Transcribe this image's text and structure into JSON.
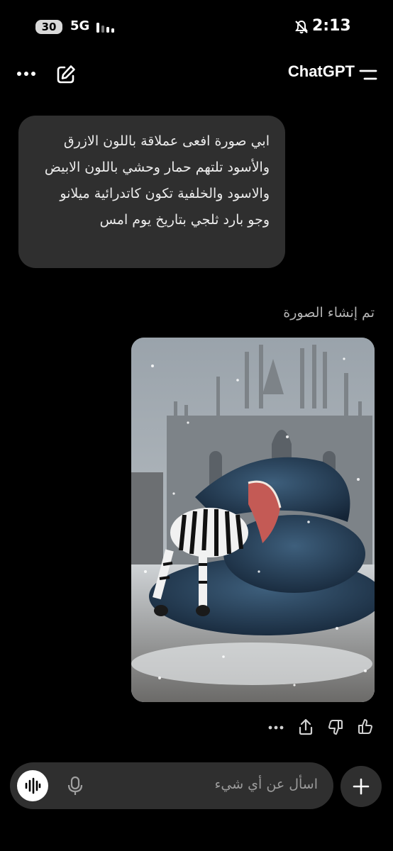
{
  "status_bar": {
    "battery": "30",
    "network": "5G",
    "time": "2:13"
  },
  "header": {
    "title": "ChatGPT",
    "icons": [
      "more-icon",
      "edit-icon",
      "menu-icon"
    ]
  },
  "conversation": {
    "user_message": "ابي صورة افعى عملاقة باللون الازرق والأسود تلتهم حمار وحشي باللون الابيض والاسود والخلفية تكون كاتدرائية ميلانو وجو بارد ثلجي بتاريخ يوم امس",
    "assistant_status": "تم إنشاء الصورة",
    "response_actions": [
      "more-icon",
      "share-icon",
      "thumbs-down-icon",
      "thumbs-up-icon"
    ]
  },
  "composer": {
    "placeholder": "اسأل عن أي شيء",
    "icons": [
      "voice-mode-icon",
      "microphone-icon",
      "plus-icon"
    ]
  }
}
